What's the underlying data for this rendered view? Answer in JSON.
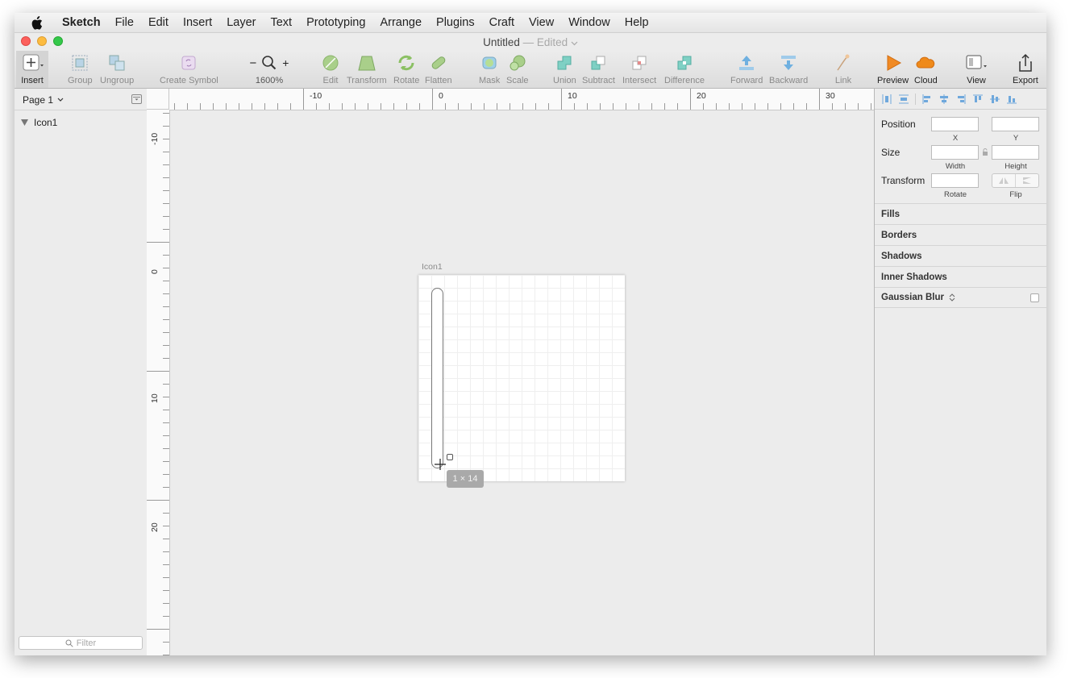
{
  "menubar": {
    "app_name": "Sketch",
    "items": [
      "File",
      "Edit",
      "Insert",
      "Layer",
      "Text",
      "Prototyping",
      "Arrange",
      "Plugins",
      "Craft",
      "View",
      "Window",
      "Help"
    ]
  },
  "window": {
    "title": "Untitled",
    "edited": "— Edited"
  },
  "toolbar": {
    "insert": "Insert",
    "group": "Group",
    "ungroup": "Ungroup",
    "create_symbol": "Create Symbol",
    "zoom_out": "−",
    "zoom_in": "+",
    "zoom": "1600%",
    "edit": "Edit",
    "transform": "Transform",
    "rotate": "Rotate",
    "flatten": "Flatten",
    "mask": "Mask",
    "scale": "Scale",
    "union": "Union",
    "subtract": "Subtract",
    "intersect": "Intersect",
    "difference": "Difference",
    "forward": "Forward",
    "backward": "Backward",
    "link": "Link",
    "preview": "Preview",
    "cloud": "Cloud",
    "view": "View",
    "export": "Export"
  },
  "layers": {
    "page": "Page 1",
    "items": [
      {
        "name": "Icon1"
      }
    ],
    "filter_placeholder": "Filter"
  },
  "rulers": {
    "horizontal": [
      "-10",
      "0",
      "10",
      "20",
      "30"
    ],
    "vertical": [
      "-10",
      "0",
      "10",
      "20"
    ]
  },
  "canvas": {
    "artboard_name": "Icon1",
    "size_tooltip": "1 × 14"
  },
  "inspector": {
    "position": {
      "label": "Position",
      "x": "X",
      "y": "Y"
    },
    "size": {
      "label": "Size",
      "width": "Width",
      "height": "Height"
    },
    "transform": {
      "label": "Transform",
      "rotate": "Rotate",
      "flip": "Flip"
    },
    "sections": [
      "Fills",
      "Borders",
      "Shadows",
      "Inner Shadows",
      "Gaussian Blur"
    ]
  }
}
